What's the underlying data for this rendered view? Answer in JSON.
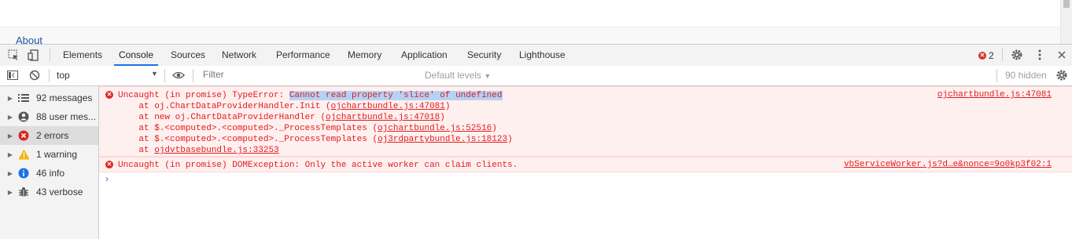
{
  "page": {
    "about_link": "About"
  },
  "devtools": {
    "tabs": [
      "Elements",
      "Console",
      "Sources",
      "Network",
      "Performance",
      "Memory",
      "Application",
      "Security",
      "Lighthouse"
    ],
    "active_tab": "Console",
    "error_count": "2"
  },
  "filterbar": {
    "context": "top",
    "filter_placeholder": "Filter",
    "levels": "Default levels",
    "hidden": "90 hidden"
  },
  "sidebar": {
    "items": [
      {
        "label": "92 messages",
        "icon": "list-icon"
      },
      {
        "label": "88 user mes...",
        "icon": "user-icon"
      },
      {
        "label": "2 errors",
        "icon": "error-icon"
      },
      {
        "label": "1 warning",
        "icon": "warning-icon"
      },
      {
        "label": "46 info",
        "icon": "info-icon"
      },
      {
        "label": "43 verbose",
        "icon": "bug-icon"
      }
    ]
  },
  "console": {
    "error1": {
      "prefix": "Uncaught (in promise) TypeError: ",
      "highlight": "Cannot read property 'slice' of undefined",
      "source": "ojchartbundle.js:47081",
      "stack": [
        {
          "pre": "    at oj.ChartDataProviderHandler.Init (",
          "link": "ojchartbundle.js:47081",
          "post": ")"
        },
        {
          "pre": "    at new oj.ChartDataProviderHandler (",
          "link": "ojchartbundle.js:47018",
          "post": ")"
        },
        {
          "pre": "    at $.<computed>.<computed>._ProcessTemplates (",
          "link": "ojchartbundle.js:52516",
          "post": ")"
        },
        {
          "pre": "    at $.<computed>.<computed>._ProcessTemplates (",
          "link": "oj3rdpartybundle.js:18123",
          "post": ")"
        },
        {
          "pre": "    at ",
          "link": "ojdvtbasebundle.js:33253",
          "post": ""
        }
      ]
    },
    "error2": {
      "text": "Uncaught (in promise) DOMException: Only the active worker can claim clients.",
      "source": "vbServiceWorker.js?d…e&nonce=9o0kp3f02:1"
    },
    "prompt": "›"
  },
  "colors": {
    "accent": "#1a73e8",
    "error": "#e21b1b",
    "error_bg": "#fff0f0"
  }
}
